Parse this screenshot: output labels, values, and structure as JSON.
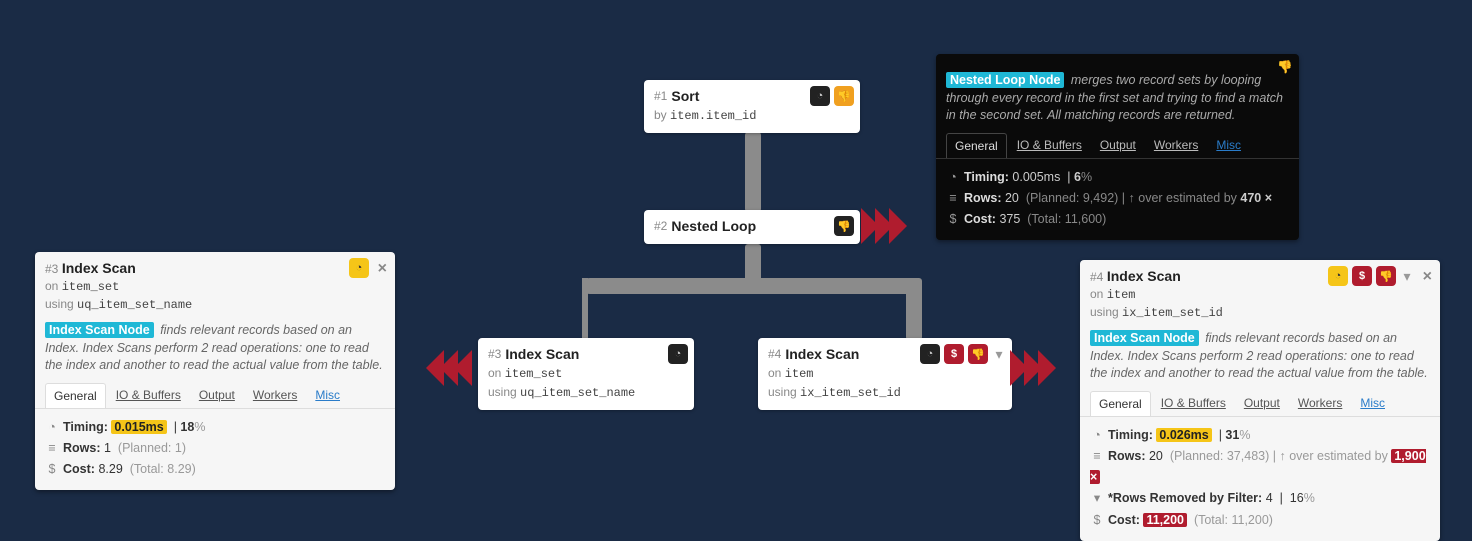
{
  "detail_desc_prefix": "Index Scan Node",
  "detail_desc_rest": " finds relevant records based on an Index. Index Scans perform 2 read operations: one to read the index and another to read the actual value from the table.",
  "nested_desc_prefix": "Nested Loop Node",
  "nested_desc_rest": " merges two record sets by looping through every record in the first set and trying to find a match in the second set. All matching records are returned.",
  "tabs": {
    "general": "General",
    "io": "IO & Buffers",
    "output": "Output",
    "workers": "Workers",
    "misc": "Misc"
  },
  "labels": {
    "by": "by",
    "on": "on",
    "using": "using",
    "timing": "Timing:",
    "rows": "Rows:",
    "cost": "Cost:",
    "removed": "*Rows Removed by Filter:",
    "planned": "Planned:",
    "total": "Total:",
    "overest": "over estimated by",
    "close": "×",
    "dollar": "$",
    "thumb_down": "👎",
    "clock": "◔",
    "filter": "▾",
    "list": "≡",
    "up": "↑"
  },
  "center": {
    "sort": {
      "num": "#1",
      "title": "Sort",
      "by": "item.item_id"
    },
    "nested": {
      "num": "#2",
      "title": "Nested Loop"
    },
    "scan3": {
      "num": "#3",
      "title": "Index Scan",
      "on": "item_set",
      "using": "uq_item_set_name"
    },
    "scan4": {
      "num": "#4",
      "title": "Index Scan",
      "on": "item",
      "using": "ix_item_set_id"
    }
  },
  "left_card": {
    "num": "#3",
    "title": "Index Scan",
    "on": "item_set",
    "using": "uq_item_set_name",
    "timing": "0.015ms",
    "timing_pct": "18",
    "rows": "1",
    "rows_planned": "1",
    "cost": "8.29",
    "cost_total": "8.29"
  },
  "top_card": {
    "timing": "0.005ms",
    "timing_pct": "6",
    "rows": "20",
    "rows_planned": "9,492",
    "overest": "470 ×",
    "cost": "375",
    "cost_total": "11,600"
  },
  "right_card": {
    "num": "#4",
    "title": "Index Scan",
    "on": "item",
    "using": "ix_item_set_id",
    "timing": "0.026ms",
    "timing_pct": "31",
    "rows": "20",
    "rows_planned": "37,483",
    "overest": "1,900 ×",
    "removed": "4",
    "removed_pct": "16",
    "cost": "11,200",
    "cost_total": "11,200"
  }
}
